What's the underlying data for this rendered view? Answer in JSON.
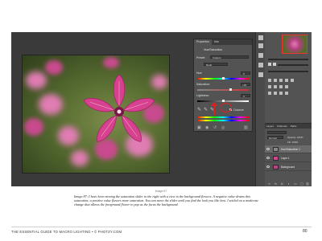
{
  "properties_panel": {
    "tabs": [
      "Properties",
      "Info"
    ],
    "title": "Hue/Saturation",
    "preset_label": "Preset:",
    "preset_value": "Custom",
    "channel_value": "Reds",
    "hue_label": "Hue:",
    "hue_value": "0",
    "saturation_label": "Saturation:",
    "saturation_value": "+33",
    "lightness_label": "Lightness:",
    "lightness_value": "0",
    "colorize_label": "Colorize"
  },
  "annotation": {
    "color": "#e0201c"
  },
  "layers_panel": {
    "tabs": [
      "Layers",
      "Channels",
      "Paths"
    ],
    "blend_mode": "Normal",
    "opacity_label": "Opacity: 100%",
    "fill_label": "Fill: 100%",
    "layers": [
      {
        "name": "Hue/Saturation 1"
      },
      {
        "name": "Layer 1"
      },
      {
        "name": "Background"
      }
    ]
  },
  "figure_label": "Image 87",
  "caption": "Image 87: I have been moving the saturation slider to the right with a view to the background flowers. A negative value drains this saturation; a positive value flavors more saturation. You can move the slider until you find the look you like best. I settled on a moderate change that allows the foreground flower to pop as the focus the background.",
  "footer": "THE ESSENTIAL GUIDE TO MACRO LIGHTING • © PHOTZY.COM",
  "page_number": "80",
  "colors": {
    "workspace": "#3a3a3a",
    "panel": "#535353",
    "flower_magenta": "#c94a8e"
  }
}
